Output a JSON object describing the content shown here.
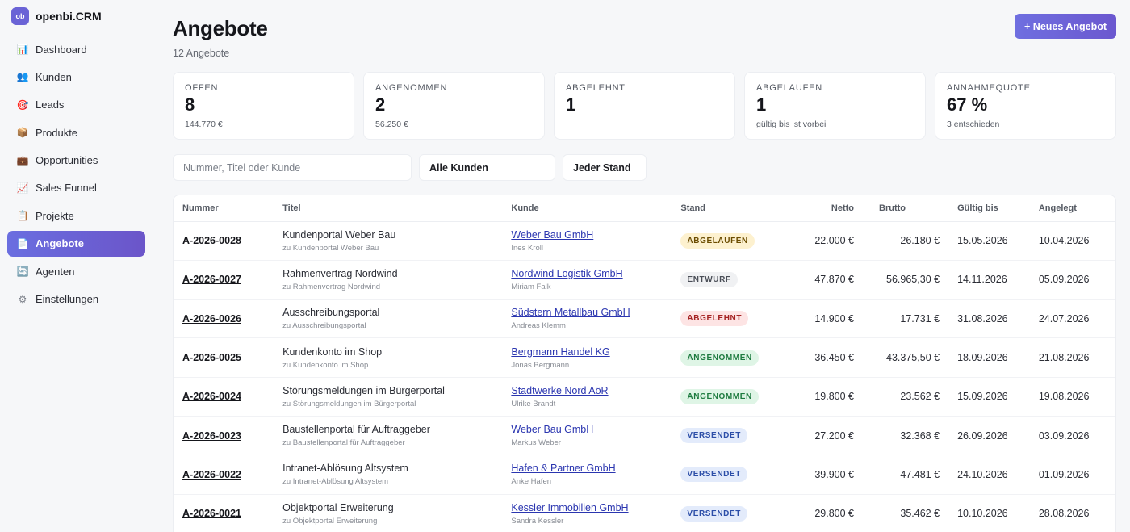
{
  "brand": {
    "logo": "ob",
    "name": "openbi.CRM"
  },
  "nav": [
    {
      "label": "Dashboard",
      "icon": "bar-chart-icon",
      "glyph": "📊",
      "active": false
    },
    {
      "label": "Kunden",
      "icon": "users-icon",
      "glyph": "👥",
      "active": false
    },
    {
      "label": "Leads",
      "icon": "target-icon",
      "glyph": "🎯",
      "active": false
    },
    {
      "label": "Produkte",
      "icon": "box-icon",
      "glyph": "📦",
      "active": false
    },
    {
      "label": "Opportunities",
      "icon": "briefcase-icon",
      "glyph": "💼",
      "active": false
    },
    {
      "label": "Sales Funnel",
      "icon": "trend-icon",
      "glyph": "📈",
      "active": false
    },
    {
      "label": "Projekte",
      "icon": "clipboard-icon",
      "glyph": "📋",
      "active": false
    },
    {
      "label": "Angebote",
      "icon": "document-icon",
      "glyph": "📄",
      "active": true
    },
    {
      "label": "Agenten",
      "icon": "agent-icon",
      "glyph": "🔄",
      "active": false
    },
    {
      "label": "Einstellungen",
      "icon": "gear-icon",
      "glyph": "⚙",
      "active": false
    }
  ],
  "header": {
    "title": "Angebote",
    "subtitle": "12 Angebote",
    "new_button": "+ Neues Angebot"
  },
  "stats": [
    {
      "label": "OFFEN",
      "value": "8",
      "sub": "144.770 €"
    },
    {
      "label": "ANGENOMMEN",
      "value": "2",
      "sub": "56.250 €"
    },
    {
      "label": "ABGELEHNT",
      "value": "1",
      "sub": ""
    },
    {
      "label": "ABGELAUFEN",
      "value": "1",
      "sub": "gültig bis ist vorbei"
    },
    {
      "label": "ANNAHMEQUOTE",
      "value": "67 %",
      "sub": "3 entschieden"
    }
  ],
  "filters": {
    "search_placeholder": "Nummer, Titel oder Kunde",
    "customer": "Alle Kunden",
    "status": "Jeder Stand"
  },
  "table": {
    "columns": [
      "Nummer",
      "Titel",
      "Kunde",
      "Stand",
      "Netto",
      "Brutto",
      "Gültig bis",
      "Angelegt"
    ],
    "rows": [
      {
        "nummer": "A-2026-0028",
        "titel": "Kundenportal Weber Bau",
        "titel_sub": "zu Kundenportal Weber Bau",
        "kunde": "Weber Bau GmbH",
        "kontakt": "Ines Kroll",
        "stand": "ABGELAUFEN",
        "stand_class": "b-abgelaufen",
        "netto": "22.000 €",
        "brutto": "26.180 €",
        "gueltig": "15.05.2026",
        "angelegt": "10.04.2026"
      },
      {
        "nummer": "A-2026-0027",
        "titel": "Rahmenvertrag Nordwind",
        "titel_sub": "zu Rahmenvertrag Nordwind",
        "kunde": "Nordwind Logistik GmbH",
        "kontakt": "Miriam Falk",
        "stand": "ENTWURF",
        "stand_class": "b-entwurf",
        "netto": "47.870 €",
        "brutto": "56.965,30 €",
        "gueltig": "14.11.2026",
        "angelegt": "05.09.2026"
      },
      {
        "nummer": "A-2026-0026",
        "titel": "Ausschreibungsportal",
        "titel_sub": "zu Ausschreibungsportal",
        "kunde": "Südstern Metallbau GmbH",
        "kontakt": "Andreas Klemm",
        "stand": "ABGELEHNT",
        "stand_class": "b-abgelehnt",
        "netto": "14.900 €",
        "brutto": "17.731 €",
        "gueltig": "31.08.2026",
        "angelegt": "24.07.2026"
      },
      {
        "nummer": "A-2026-0025",
        "titel": "Kundenkonto im Shop",
        "titel_sub": "zu Kundenkonto im Shop",
        "kunde": "Bergmann Handel KG",
        "kontakt": "Jonas Bergmann",
        "stand": "ANGENOMMEN",
        "stand_class": "b-angenommen",
        "netto": "36.450 €",
        "brutto": "43.375,50 €",
        "gueltig": "18.09.2026",
        "angelegt": "21.08.2026"
      },
      {
        "nummer": "A-2026-0024",
        "titel": "Störungsmeldungen im Bürgerportal",
        "titel_sub": "zu Störungsmeldungen im Bürgerportal",
        "kunde": "Stadtwerke Nord AöR",
        "kontakt": "Ulrike Brandt",
        "stand": "ANGENOMMEN",
        "stand_class": "b-angenommen",
        "netto": "19.800 €",
        "brutto": "23.562 €",
        "gueltig": "15.09.2026",
        "angelegt": "19.08.2026"
      },
      {
        "nummer": "A-2026-0023",
        "titel": "Baustellenportal für Auftraggeber",
        "titel_sub": "zu Baustellenportal für Auftraggeber",
        "kunde": "Weber Bau GmbH",
        "kontakt": "Markus Weber",
        "stand": "VERSENDET",
        "stand_class": "b-versendet",
        "netto": "27.200 €",
        "brutto": "32.368 €",
        "gueltig": "26.09.2026",
        "angelegt": "03.09.2026"
      },
      {
        "nummer": "A-2026-0022",
        "titel": "Intranet-Ablösung Altsystem",
        "titel_sub": "zu Intranet-Ablösung Altsystem",
        "kunde": "Hafen & Partner GmbH",
        "kontakt": "Anke Hafen",
        "stand": "VERSENDET",
        "stand_class": "b-versendet",
        "netto": "39.900 €",
        "brutto": "47.481 €",
        "gueltig": "24.10.2026",
        "angelegt": "01.09.2026"
      },
      {
        "nummer": "A-2026-0021",
        "titel": "Objektportal Erweiterung",
        "titel_sub": "zu Objektportal Erweiterung",
        "kunde": "Kessler Immobilien GmbH",
        "kontakt": "Sandra Kessler",
        "stand": "VERSENDET",
        "stand_class": "b-versendet",
        "netto": "29.800 €",
        "brutto": "35.462 €",
        "gueltig": "10.10.2026",
        "angelegt": "28.08.2026"
      }
    ]
  }
}
